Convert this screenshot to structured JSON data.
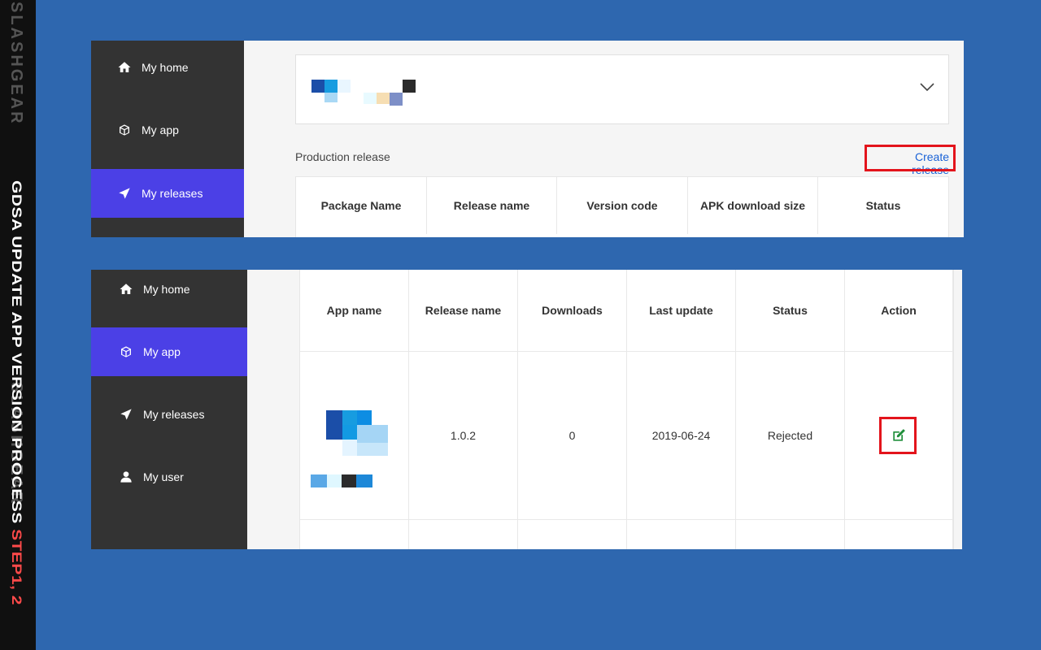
{
  "watermark": {
    "brand": "SLASHGEAR"
  },
  "caption": {
    "main": "GDSA UPDATE APP VERSION PROCESS ",
    "highlight": "STEP1, 2"
  },
  "panel_top": {
    "sidebar": [
      {
        "label": "My home",
        "icon": "home-icon",
        "active": false
      },
      {
        "label": "My app",
        "icon": "box-icon",
        "active": false
      },
      {
        "label": "My releases",
        "icon": "send-icon",
        "active": true
      }
    ],
    "app_selector": {
      "dropdown_icon": "chevron-down-icon"
    },
    "section_title": "Production release",
    "create_release": "Create release",
    "table_headers": [
      "Package Name",
      "Release name",
      "Version code",
      "APK download size",
      "Status"
    ]
  },
  "panel_bottom": {
    "sidebar": [
      {
        "label": "My home",
        "icon": "home-icon",
        "active": false
      },
      {
        "label": "My app",
        "icon": "box-icon",
        "active": true
      },
      {
        "label": "My releases",
        "icon": "send-icon",
        "active": false
      },
      {
        "label": "My user",
        "icon": "user-icon",
        "active": false
      }
    ],
    "table_headers": [
      "App name",
      "Release name",
      "Downloads",
      "Last update",
      "Status",
      "Action"
    ],
    "rows": [
      {
        "release_name": "1.0.2",
        "downloads": "0",
        "last_update": "2019-06-24",
        "status": "Rejected",
        "action_icon": "edit-icon"
      }
    ]
  },
  "colors": {
    "background": "#2e67af",
    "sidebar": "#333333",
    "active": "#4b40e6",
    "link": "#1a62d6",
    "highlight": "#e3141c"
  }
}
